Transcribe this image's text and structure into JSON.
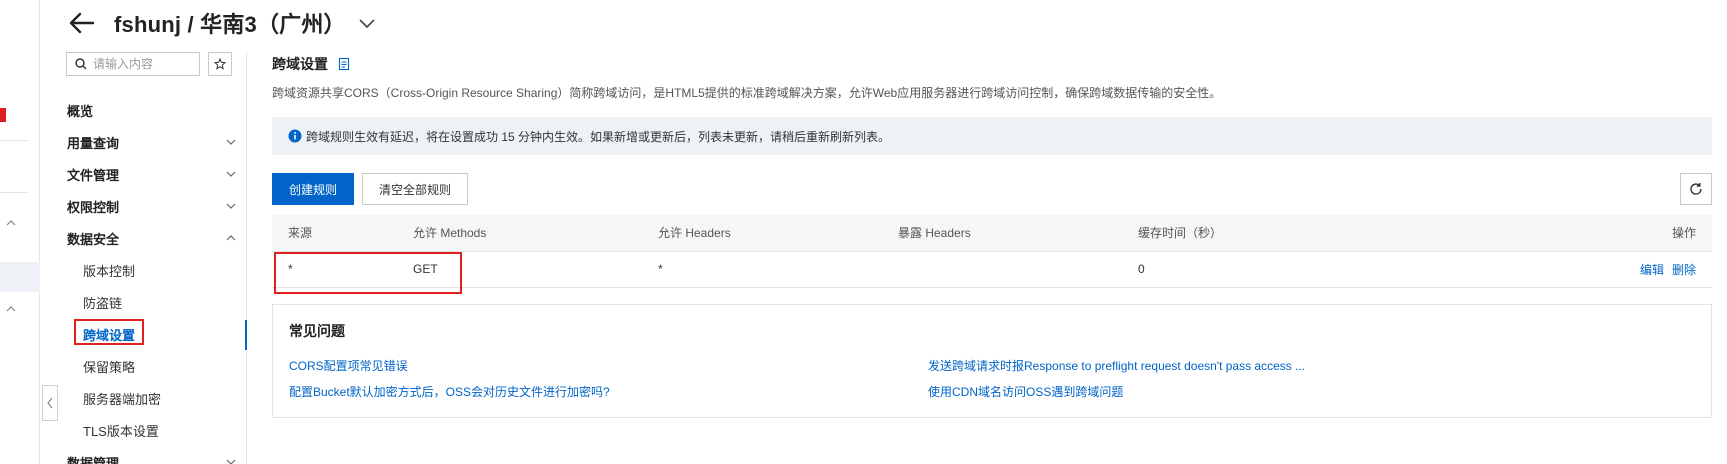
{
  "header": {
    "title": "fshunj / 华南3（广州）"
  },
  "sidebar": {
    "search_placeholder": "请输入内容",
    "items": [
      {
        "label": "概览"
      },
      {
        "label": "用量查询"
      },
      {
        "label": "文件管理"
      },
      {
        "label": "权限控制"
      },
      {
        "label": "数据安全"
      },
      {
        "label": "版本控制"
      },
      {
        "label": "防盗链"
      },
      {
        "label": "跨域设置"
      },
      {
        "label": "保留策略"
      },
      {
        "label": "服务器端加密"
      },
      {
        "label": "TLS版本设置"
      },
      {
        "label": "数据管理"
      }
    ]
  },
  "main": {
    "title": "跨域设置",
    "description": "跨域资源共享CORS（Cross-Origin Resource Sharing）简称跨域访问，是HTML5提供的标准跨域解决方案，允许Web应用服务器进行跨域访问控制，确保跨域数据传输的安全性。",
    "notice": "跨域规则生效有延迟，将在设置成功 15 分钟内生效。如果新增或更新后，列表未更新，请稍后重新刷新列表。",
    "create_button": "创建规则",
    "clear_button": "清空全部规则",
    "table": {
      "headers": [
        "来源",
        "允许 Methods",
        "允许 Headers",
        "暴露 Headers",
        "缓存时间（秒）",
        "操作"
      ],
      "rows": [
        {
          "origin": "*",
          "methods": "GET",
          "allow_headers": "*",
          "expose_headers": "",
          "max_age": "0",
          "edit": "编辑",
          "delete": "删除"
        }
      ]
    },
    "faq": {
      "title": "常见问题",
      "links": [
        "CORS配置项常见错误",
        "发送跨域请求时报Response to preflight request doesn't pass access ...",
        "配置Bucket默认加密方式后，OSS会对历史文件进行加密吗?",
        "使用CDN域名访问OSS遇到跨域问题"
      ]
    }
  },
  "colors": {
    "primary": "#0064c8",
    "highlight": "#e0201e",
    "notice_bg": "#eef2f7"
  }
}
